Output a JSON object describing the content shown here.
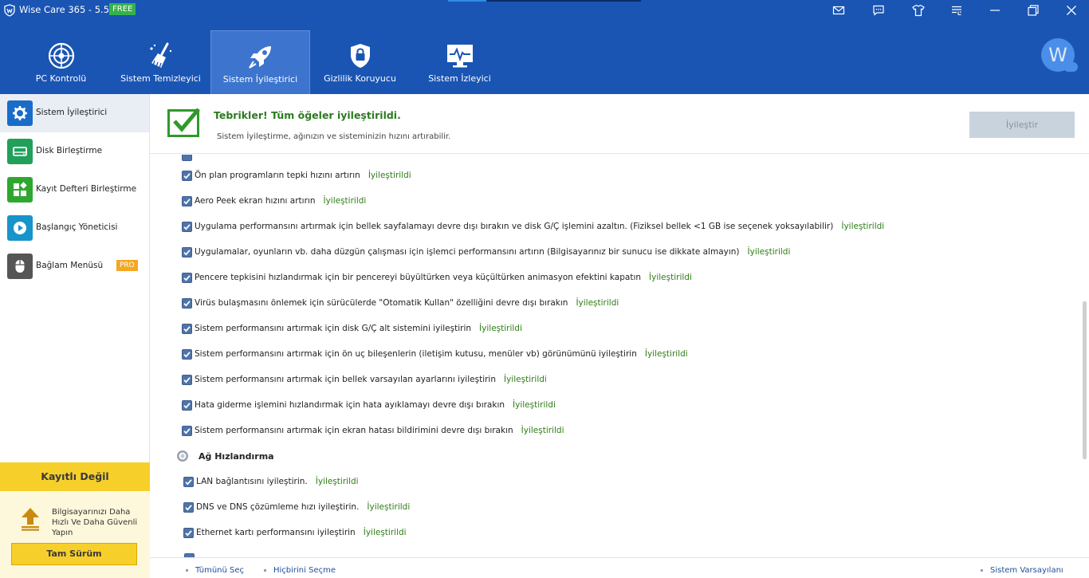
{
  "window": {
    "title": "Wise Care 365 - 5.5.8",
    "badge": "FREE",
    "icons": [
      "shield-logo-icon",
      "mail-icon",
      "chat-icon",
      "shirt-icon",
      "menu-icon",
      "minimize-icon",
      "restore-icon",
      "close-icon"
    ]
  },
  "nav": {
    "tabs": [
      {
        "label": "PC Kontrolü",
        "icon": "radar-icon"
      },
      {
        "label": "Sistem Temizleyici",
        "icon": "broom-icon"
      },
      {
        "label": "Sistem İyileştirici",
        "icon": "rocket-icon",
        "active": true
      },
      {
        "label": "Gizlilik Koruyucu",
        "icon": "privacy-lock-icon"
      },
      {
        "label": "Sistem İzleyici",
        "icon": "monitor-icon"
      }
    ],
    "avatar_letter": "W"
  },
  "sidebar": {
    "items": [
      {
        "label": "Sistem İyileştirici",
        "icon": "gear-icon",
        "color": "#1a6cc9",
        "active": true
      },
      {
        "label": "Disk Birleştirme",
        "icon": "disk-icon",
        "color": "#21a05a"
      },
      {
        "label": "Kayıt Defteri Birleştirme",
        "icon": "registry-icon",
        "color": "#2fa72f"
      },
      {
        "label": "Başlangıç Yöneticisi",
        "icon": "play-icon",
        "color": "#1794c9"
      },
      {
        "label": "Bağlam Menüsü",
        "icon": "mouse-icon",
        "color": "#555555",
        "badge": "PRO"
      }
    ],
    "unregistered": {
      "title": "Kayıtlı Değil",
      "text": "Bilgisayarınızı Daha Hızlı Ve Daha Güvenli Yapın",
      "button": "Tam Sürüm"
    }
  },
  "main": {
    "message_title": "Tebrikler! Tüm öğeler iyileştirildi.",
    "message_sub": "Sistem İyileştirme, ağınızın ve sisteminizin hızını artırabilir.",
    "optimize_button": "İyileştir",
    "status_label": "İyileştirildi",
    "items": [
      {
        "text": "Ön plan programların tepki hızını artırın",
        "status": "İyileştirildi",
        "checked": true
      },
      {
        "text": "Aero Peek ekran hızını artırın",
        "status": "İyileştirildi",
        "checked": true
      },
      {
        "text": "Uygulama performansını artırmak için bellek sayfalamayı devre dışı bırakın ve disk G/Ç işlemini azaltın. (Fiziksel bellek <1 GB ise seçenek yoksayılabilir)",
        "status": "İyileştirildi",
        "checked": true
      },
      {
        "text": "Uygulamalar, oyunların vb. daha düzgün çalışması için işlemci performansını artırın (Bilgisayarınız bir sunucu ise dikkate almayın)",
        "status": "İyileştirildi",
        "checked": true
      },
      {
        "text": "Pencere tepkisini hızlandırmak için bir pencereyi büyültürken veya küçültürken animasyon efektini kapatın",
        "status": "İyileştirildi",
        "checked": true
      },
      {
        "text": "Virüs bulaşmasını önlemek için sürücülerde \"Otomatik Kullan\" özelliğini devre dışı bırakın",
        "status": "İyileştirildi",
        "checked": true
      },
      {
        "text": "Sistem performansını artırmak için disk G/Ç alt sistemini iyileştirin",
        "status": "İyileştirildi",
        "checked": true
      },
      {
        "text": "Sistem performansını artırmak için ön uç bileşenlerin (iletişim kutusu, menüler vb) görünümünü iyileştirin",
        "status": "İyileştirildi",
        "checked": true
      },
      {
        "text": "Sistem performansını artırmak için bellek varsayılan ayarlarını iyileştirin",
        "status": "İyileştirildi",
        "checked": true
      },
      {
        "text": "Hata giderme işlemini hızlandırmak için hata ayıklamayı devre dışı bırakın",
        "status": "İyileştirildi",
        "checked": true
      },
      {
        "text": "Sistem performansını artırmak için ekran hatası bildirimini devre dışı bırakın",
        "status": "İyileştirildi",
        "checked": true
      }
    ],
    "network_section": {
      "title": "Ağ Hızlandırma",
      "icon": "globe-icon",
      "items": [
        {
          "text": "LAN bağlantısını iyileştirin.",
          "status": "İyileştirildi",
          "checked": true
        },
        {
          "text": "DNS ve DNS çözümleme hızı iyileştirin.",
          "status": "İyileştirildi",
          "checked": true
        },
        {
          "text": "Ethernet kartı performansını iyileştirin",
          "status": "İyileştirildi",
          "checked": true
        }
      ]
    },
    "bottom": {
      "select_all": "Tümünü Seç",
      "select_none": "Hiçbirini Seçme",
      "defaults": "Sistem Varsayılanı"
    }
  }
}
